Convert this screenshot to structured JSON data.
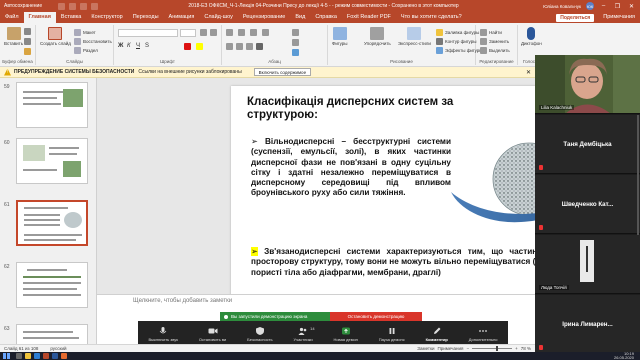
{
  "titlebar": {
    "autosave_label": "Автосохранение",
    "autosave_state": "Откл",
    "document_title": "2018-ЕЗ ОФКСМ_Ч-1-Лекція 04-Розчини Пресу до лекції 4-5 -  - режим совместимости  -  Сохранено в этот компьютер",
    "user_name": "Юліана Ковальчук",
    "user_initials": "ЮК"
  },
  "ribbon_tabs": [
    {
      "label": "Файл"
    },
    {
      "label": "Главная"
    },
    {
      "label": "Вставка"
    },
    {
      "label": "Конструктор"
    },
    {
      "label": "Переходы"
    },
    {
      "label": "Анимация"
    },
    {
      "label": "Слайд-шоу"
    },
    {
      "label": "Рецензирование"
    },
    {
      "label": "Вид"
    },
    {
      "label": "Справка"
    },
    {
      "label": "Foxit Reader PDF"
    },
    {
      "label": "Что вы хотите сделать?"
    }
  ],
  "ribbon_actions": {
    "share": "Поделиться",
    "comments": "Примечания"
  },
  "ribbon_groups": {
    "clipboard": {
      "label": "Буфер обмена",
      "paste": "Вставить"
    },
    "slides": {
      "label": "Слайды",
      "new_slide": "Создать слайд",
      "layout": "Макет",
      "reset": "Восстановить",
      "section": "Раздел"
    },
    "font": {
      "label": "Шрифт"
    },
    "paragraph": {
      "label": "Абзац"
    },
    "drawing": {
      "label": "Рисование",
      "shapes": "Фигуры",
      "arrange": "Упорядочить",
      "quick_styles": "Экспресс-стили",
      "fill": "Заливка фигуры",
      "outline": "Контур фигуры",
      "effects": "Эффекты фигуры"
    },
    "editing": {
      "label": "Редактирование",
      "find": "Найти",
      "replace": "Заменить",
      "select": "Выделить"
    },
    "voice": {
      "label": "Голос",
      "dictate": "Диктофон"
    }
  },
  "security_bar": {
    "title": "ПРЕДУПРЕЖДЕНИЕ СИСТЕМЫ БЕЗОПАСНОСТИ",
    "message": "Ссылки на внешние рисунки заблокированы",
    "button": "Включить содержимое"
  },
  "thumbnails": [
    {
      "number": "59"
    },
    {
      "number": "60"
    },
    {
      "number": "61"
    },
    {
      "number": "62"
    },
    {
      "number": "63"
    }
  ],
  "slide": {
    "title": "Класифікація дисперсних систем за структурою:",
    "marker": "➢",
    "para1": "Вільнодисперсні – бесструктурні системи (суспензії, емульсії, золі), в яких частинки дисперсної фази не пов'язані в одну суцільну сітку і здатні незалежно переміщуватися в дисперсному середовищі під впливом броунівського руху або сили тяжіння.",
    "para2": "Зв'язанодисперсні системи характеризуються тим, що частинки утворюють просторову структуру, тому вони не можуть вільно переміщуватися (гелі, капілярно-пористі тіла або діафрагми, мембрани, драглі)",
    "page_number": "61"
  },
  "notes_placeholder": "Щелкните, чтобы добавить заметки",
  "zoom": {
    "sharing_banner": "Вы запустили демонстрацию экрана",
    "stop_sharing": "Остановить демонстрацию",
    "toolbar": [
      {
        "label": "Выключить звук"
      },
      {
        "label": "Остановить ви"
      },
      {
        "label": "Безопасность"
      },
      {
        "label": "Участники",
        "badge": "14"
      },
      {
        "label": "Новая демон"
      },
      {
        "label": "Пауза демонс"
      },
      {
        "label": "Комментир"
      },
      {
        "label": "Дополнительно"
      }
    ]
  },
  "participants": [
    {
      "name": "Lilia Kalachniuk",
      "display": "video"
    },
    {
      "name": "Таня Дембіцька",
      "display": "name"
    },
    {
      "name": "Шведченко Кат...",
      "display": "name"
    },
    {
      "name": "Люда Топчій",
      "display": "small"
    },
    {
      "name": "Ірина Лимарен...",
      "display": "name"
    }
  ],
  "statusbar": {
    "slide_info": "Слайд 61 из 108",
    "language": "русский",
    "notes": "Заметки",
    "comments": "Примечания",
    "zoom": "78 %"
  },
  "taskbar": {
    "time": "10:19",
    "date": "26.05.2020"
  },
  "colors": {
    "ppt_accent": "#b7472a",
    "zoom_green": "#2d8c3c",
    "zoom_red": "#d9352a",
    "highlight": "#ffff00"
  }
}
